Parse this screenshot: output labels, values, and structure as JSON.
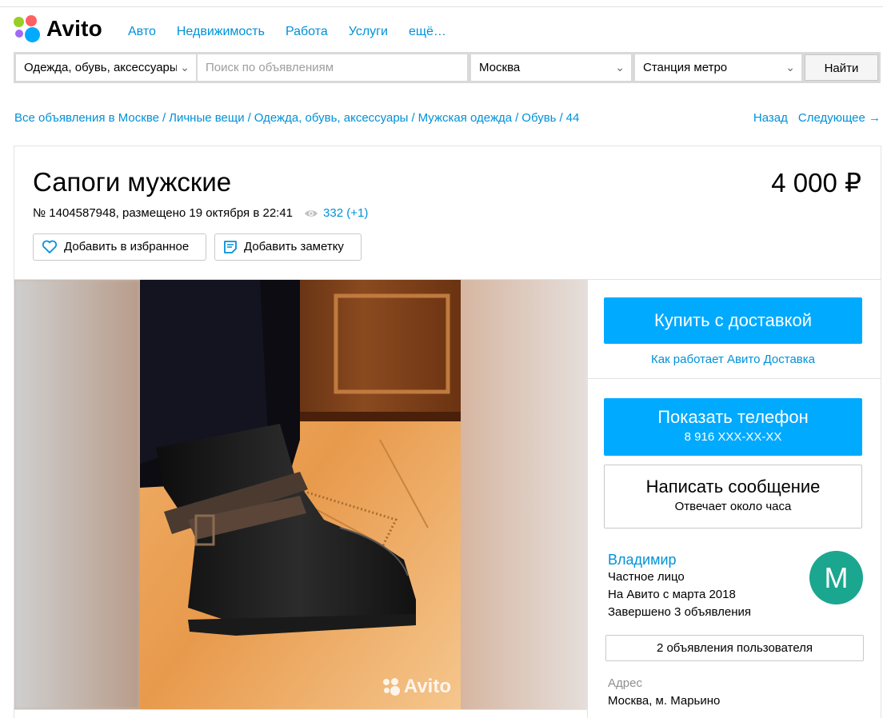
{
  "header": {
    "logo_text": "Avito",
    "nav": [
      "Авто",
      "Недвижимость",
      "Работа",
      "Услуги",
      "ещё…"
    ]
  },
  "search": {
    "category": "Одежда, обувь, аксессуары",
    "placeholder": "Поиск по объявлениям",
    "city": "Москва",
    "metro": "Станция метро",
    "button": "Найти"
  },
  "breadcrumbs": [
    "Все объявления в Москве",
    "Личные вещи",
    "Одежда, обувь, аксессуары",
    "Мужская одежда",
    "Обувь",
    "44"
  ],
  "pager": {
    "back": "Назад",
    "next": "Следующее →"
  },
  "listing": {
    "title": "Сапоги мужские",
    "price": "4 000 ₽",
    "meta": "№ 1404587948, размещено 19 октября в 22:41",
    "views": "332 (+1)",
    "favorite_button": "Добавить в избранное",
    "note_button": "Добавить заметку",
    "watermark": "Avito"
  },
  "sidebar": {
    "buy_button": "Купить с доставкой",
    "delivery_link": "Как работает Авито Доставка",
    "phone_button": "Показать телефон",
    "phone_number": "8 916 XXX-XX-XX",
    "message_button": "Написать сообщение",
    "message_sub": "Отвечает около часа",
    "seller": {
      "name": "Владимир",
      "type": "Частное лицо",
      "since": "На Авито с марта 2018",
      "completed": "Завершено 3 объявления",
      "avatar_letter": "M"
    },
    "ads_button": "2 объявления пользователя",
    "address_label": "Адрес",
    "address_value": "Москва, м. Марьино"
  },
  "colors": {
    "accent_blue": "#00aaff",
    "link_blue": "#0091d9",
    "avatar_green": "#1ba68f"
  }
}
